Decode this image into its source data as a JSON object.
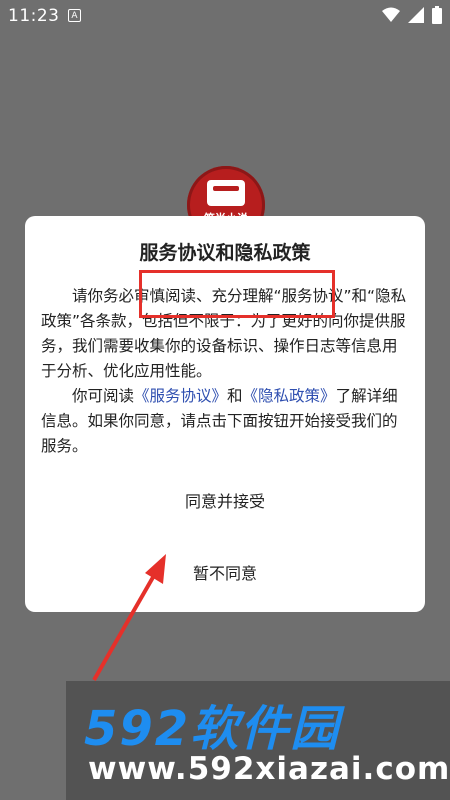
{
  "status_bar": {
    "time": "11:23",
    "badge": "A"
  },
  "app_logo": {
    "text": "笔尚小说"
  },
  "dialog": {
    "title": "服务协议和隐私政策",
    "para1": "请你务必审慎阅读、充分理解“服务协议”和“隐私政策”各条款，包括但不限于：为了更好的向你提供服务，我们需要收集你的设备标识、操作日志等信息用于分析、优化应用性能。",
    "para2_prefix": "你可阅读",
    "link_service": "《服务协议》",
    "para2_and": "和",
    "link_privacy": "《隐私政策》",
    "para2_suffix": "了解详细信息。如果你同意，请点击下面按钮开始接受我们的服务。",
    "accept_label": "同意并接受",
    "decline_label": "暂不同意"
  },
  "watermark": {
    "brand": "592软件园",
    "url": "www.592xiazai.com"
  },
  "colors": {
    "highlight": "#e5302a",
    "link": "#2f4fb0",
    "brand": "#1e8df0"
  }
}
